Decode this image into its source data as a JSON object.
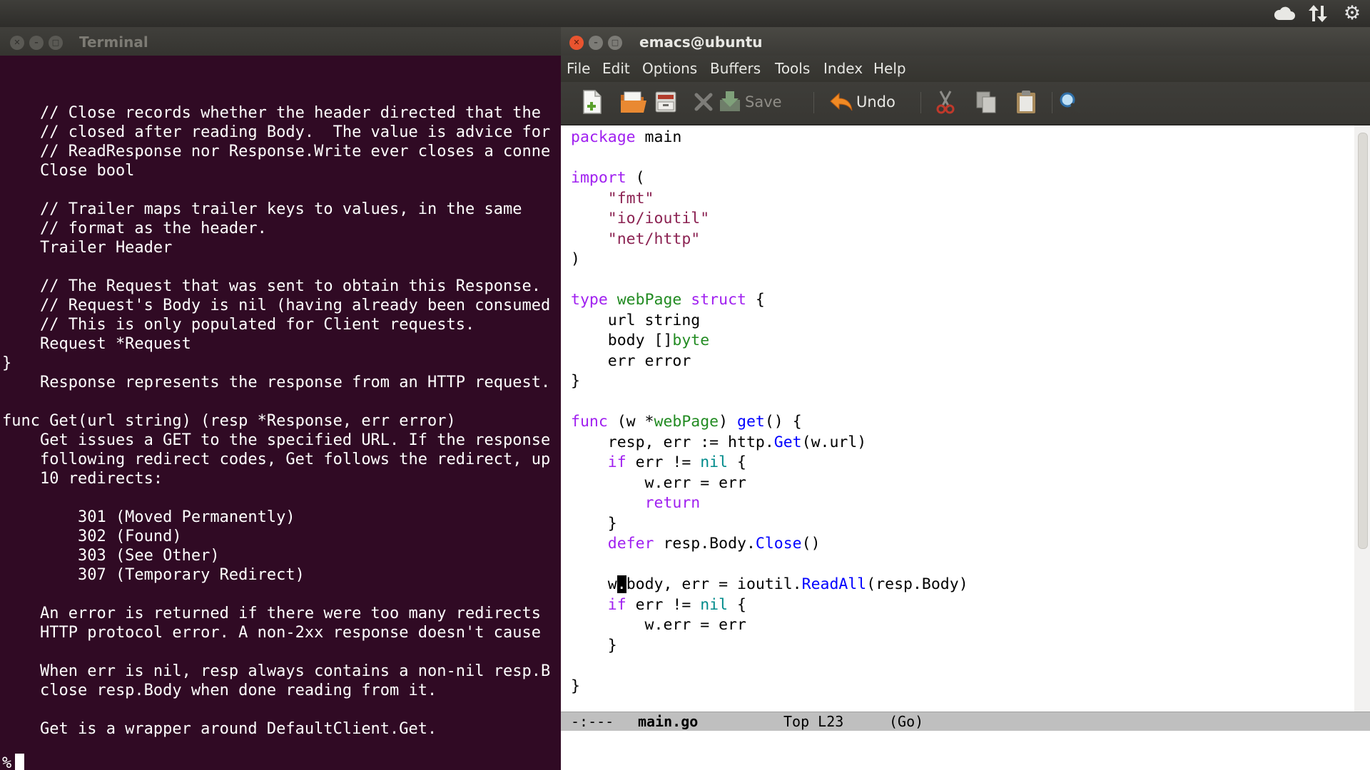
{
  "top_panel": {
    "icons": [
      "cloud-icon",
      "network-arrows-icon",
      "gear-icon"
    ]
  },
  "terminal": {
    "title": "Terminal",
    "lines": [
      "    // Close records whether the header directed that the",
      "    // closed after reading Body.  The value is advice for",
      "    // ReadResponse nor Response.Write ever closes a conne",
      "    Close bool",
      "",
      "    // Trailer maps trailer keys to values, in the same",
      "    // format as the header.",
      "    Trailer Header",
      "",
      "    // The Request that was sent to obtain this Response.",
      "    // Request's Body is nil (having already been consumed",
      "    // This is only populated for Client requests.",
      "    Request *Request",
      "}",
      "    Response represents the response from an HTTP request.",
      "",
      "func Get(url string) (resp *Response, err error)",
      "    Get issues a GET to the specified URL. If the response",
      "    following redirect codes, Get follows the redirect, up",
      "    10 redirects:",
      "",
      "        301 (Moved Permanently)",
      "        302 (Found)",
      "        303 (See Other)",
      "        307 (Temporary Redirect)",
      "",
      "    An error is returned if there were too many redirects",
      "    HTTP protocol error. A non-2xx response doesn't cause",
      "",
      "    When err is nil, resp always contains a non-nil resp.B",
      "    close resp.Body when done reading from it.",
      "",
      "    Get is a wrapper around DefaultClient.Get."
    ],
    "prompt": "%"
  },
  "emacs": {
    "title": "emacs@ubuntu",
    "menu": [
      "File",
      "Edit",
      "Options",
      "Buffers",
      "Tools",
      "Index",
      "Help"
    ],
    "toolbar": {
      "save_label": "Save",
      "undo_label": "Undo"
    },
    "code": {
      "l1": [
        "package",
        " main"
      ],
      "l3": [
        "import",
        " ("
      ],
      "l4": "\"fmt\"",
      "l5": "\"io/ioutil\"",
      "l6": "\"net/http\"",
      "l7": ")",
      "l9": [
        "type",
        "webPage",
        "struct",
        " {"
      ],
      "l10": "    url string",
      "l11": [
        "    body []",
        "byte"
      ],
      "l12": "    err error",
      "l13": "}",
      "l15": [
        "func",
        " (w *",
        "webPage",
        ") ",
        "get",
        "() {"
      ],
      "l16": [
        "    resp, err := http.",
        "Get",
        "(w.url)"
      ],
      "l17": [
        "    ",
        "if",
        " err != ",
        "nil",
        " {"
      ],
      "l18": "        w.err = err",
      "l19": [
        "        ",
        "return"
      ],
      "l20": "    }",
      "l21": [
        "    ",
        "defer",
        " resp.Body.",
        "Close",
        "()"
      ],
      "l23": [
        "    w",
        ".",
        "body, err = ioutil.",
        "ReadAll",
        "(resp.Body)"
      ],
      "l24": [
        "    ",
        "if",
        " err != ",
        "nil",
        " {"
      ],
      "l25": "        w.err = err",
      "l26": "    }",
      "l28": "}"
    },
    "modeline": {
      "status": "-:---",
      "buffer": "main.go",
      "position": "Top L23",
      "mode": "(Go)"
    },
    "colors": {
      "keyword": "#a020f0",
      "string": "#8b2252",
      "type": "#228b22",
      "function": "#0000ff",
      "constant": "#008b8b"
    }
  }
}
